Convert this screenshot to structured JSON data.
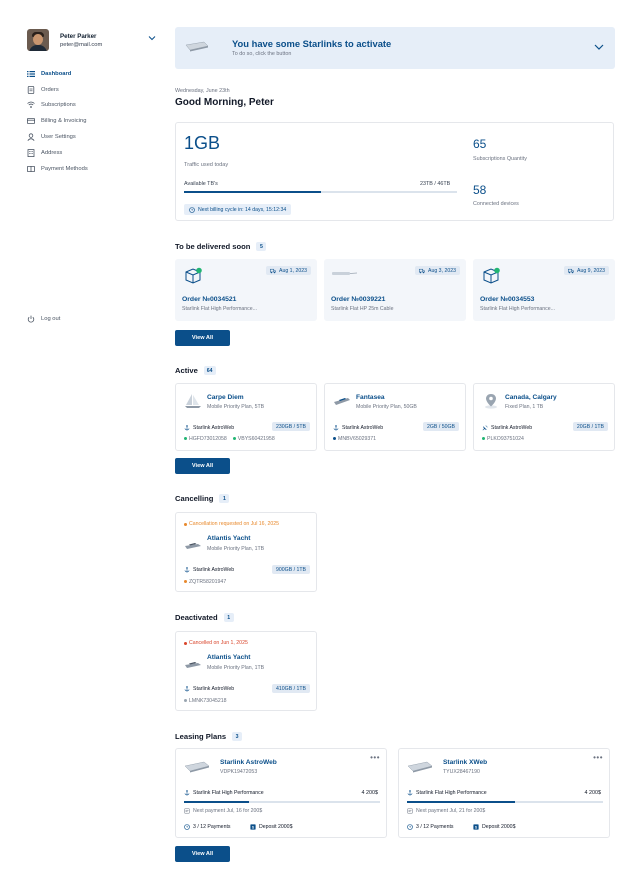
{
  "profile": {
    "name": "Peter Parker",
    "email": "peter@mail.com"
  },
  "nav": [
    {
      "label": "Dashboard",
      "icon": "list-icon",
      "active": true
    },
    {
      "label": "Orders",
      "icon": "document-icon"
    },
    {
      "label": "Subscriptions",
      "icon": "wifi-icon"
    },
    {
      "label": "Billing & Invoicing",
      "icon": "credit-card-icon"
    },
    {
      "label": "User Settings",
      "icon": "user-icon"
    },
    {
      "label": "Address",
      "icon": "building-icon"
    },
    {
      "label": "Payment Methods",
      "icon": "wallet-icon"
    }
  ],
  "logout_label": "Log out",
  "banner": {
    "title": "You have some Starlinks to activate",
    "subtitle": "To do so, click the button"
  },
  "date": "Wednesday, June 23th",
  "greeting": "Good Morning, Peter",
  "stats": {
    "traffic_value": "1GB",
    "traffic_label": "Traffic used today",
    "available_label": "Available TB's",
    "available_value": "23TB / 46TB",
    "available_fraction": 0.5,
    "billing_cycle": "Next billing cycle in: 14 days, 15:12:34",
    "subscriptions_value": "65",
    "subscriptions_label": "Subscriptions Quantity",
    "devices_value": "58",
    "devices_label": "Connected devices"
  },
  "delivered": {
    "title": "To be delivered soon",
    "count": "5",
    "orders": [
      {
        "date": "Aug 1, 2023",
        "title": "Order №0034521",
        "desc": "Starlink Flat High Performance...",
        "icon": "box-icon"
      },
      {
        "date": "Aug 3, 2023",
        "title": "Order №0039221",
        "desc": "Starlink Flat HP 25m Cable",
        "icon": "cable-icon"
      },
      {
        "date": "Aug 9, 2023",
        "title": "Order №0034553",
        "desc": "Starlink Flat High Performance...",
        "icon": "box-icon"
      }
    ]
  },
  "view_all": "View All",
  "active": {
    "title": "Active",
    "count": "64",
    "items": [
      {
        "name": "Carpe Diem",
        "plan": "Mobile Priority Plan, 5TB",
        "product": "Starlink AstroWeb",
        "usage": "230GB / 5TB",
        "serials": [
          "HGFD73012058",
          "VBYS60421958"
        ],
        "icon": "sailboat-icon"
      },
      {
        "name": "Fantasea",
        "plan": "Mobile Priority Plan, 50GB",
        "product": "Starlink AstroWeb",
        "usage": "2GB / 50GB",
        "serials": [
          "MNBV65029371"
        ],
        "icon": "yacht-icon"
      },
      {
        "name": "Canada, Calgary",
        "plan": "Fixed Plan, 1 TB",
        "product": "Starlink AstroWeb",
        "usage": "20GB / 1TB",
        "serials": [
          "PLKO93751024"
        ],
        "icon": "location-icon"
      }
    ]
  },
  "cancelling": {
    "title": "Cancelling",
    "count": "1",
    "status": "Cancellation requested on Jul 16, 2025",
    "status_color": "#e8892c",
    "name": "Atlantis Yacht",
    "plan": "Mobile Priority Plan, 1TB",
    "product": "Starlink AstroWeb",
    "usage": "900GB / 1TB",
    "serial": "ZQTR58201947"
  },
  "deactivated": {
    "title": "Deactivated",
    "count": "1",
    "status": "Cancelled on Jun 1, 2025",
    "status_color": "#d9452b",
    "name": "Atlantis Yacht",
    "plan": "Mobile Priority Plan, 1TB",
    "product": "Starlink AstroWeb",
    "usage": "410GB / 1TB",
    "serial": "LMNK73045218"
  },
  "leasing": {
    "title": "Leasing Plans",
    "count": "3",
    "plans": [
      {
        "name": "Starlink AstroWeb",
        "id": "VDPK19472053",
        "product": "Starlink Flat High Performance",
        "price": "4 200$",
        "progress": 0.33,
        "next": "Next payment Jul, 16 for 200$",
        "payments": "3 / 12 Payments",
        "deposit": "Deposit 2000$"
      },
      {
        "name": "Starlink XWeb",
        "id": "TYUX28467190",
        "product": "Starlink Flat High Performance",
        "price": "4 200$",
        "progress": 0.55,
        "next": "Next payment Jul, 21 for 200$",
        "payments": "3 / 12 Payments",
        "deposit": "Deposit 2000$"
      }
    ]
  },
  "colors": {
    "accent": "#0b4f8a",
    "chip_bg": "#e6eef8",
    "green_dot": "#22b573",
    "blue_dot": "#0b4f8a"
  }
}
